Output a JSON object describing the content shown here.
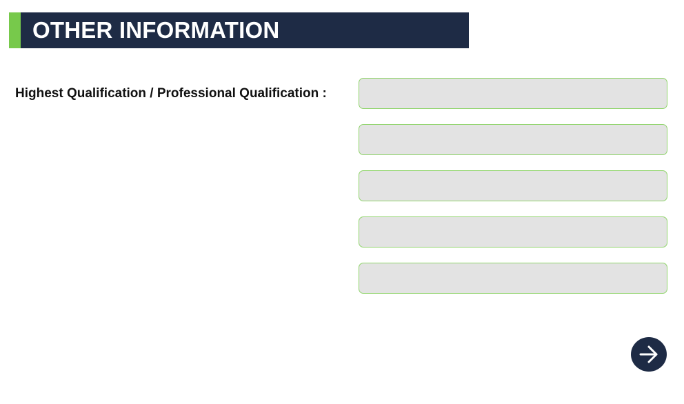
{
  "section": {
    "title": "OTHER INFORMATION"
  },
  "form": {
    "qualification_label": "Highest Qualification / Professional Qualification :",
    "fields": [
      {
        "value": "",
        "placeholder": ""
      },
      {
        "value": "",
        "placeholder": ""
      },
      {
        "value": "",
        "placeholder": ""
      },
      {
        "value": "",
        "placeholder": ""
      },
      {
        "value": "",
        "placeholder": ""
      }
    ]
  },
  "navigation": {
    "next_icon": "arrow-right-icon"
  },
  "colors": {
    "header_bg": "#1e2b45",
    "accent": "#77c94b",
    "field_bg": "#e3e3e3",
    "field_border": "#8fd46a",
    "button_bg": "#1e2b45"
  }
}
